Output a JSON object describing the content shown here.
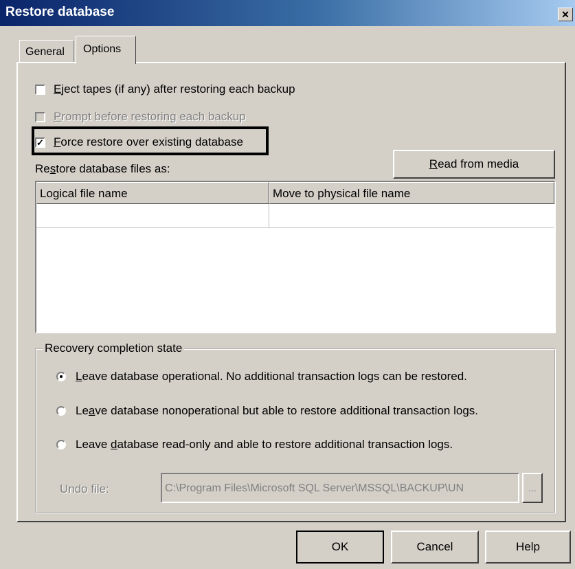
{
  "window": {
    "title": "Restore database",
    "close_icon": "close-icon"
  },
  "tabs": [
    {
      "label": "General"
    },
    {
      "label": "Options"
    }
  ],
  "options": {
    "eject": {
      "pre": "",
      "key": "E",
      "rest": "ject tapes (if any) after restoring each backup",
      "checked": false
    },
    "prompt": {
      "pre": "",
      "key": "P",
      "rest": "rompt before restoring each backup",
      "checked": false,
      "disabled": true
    },
    "force": {
      "pre": "",
      "key": "F",
      "rest": "orce restore over existing database",
      "checked": true
    }
  },
  "restore_files": {
    "label_pre": "Re",
    "label_key": "s",
    "label_rest": "tore database files as:",
    "read_button_key": "R",
    "read_button_rest": "ead from media",
    "columns": [
      "Logical file name",
      "Move to physical file name"
    ]
  },
  "recovery": {
    "legend": "Recovery completion state",
    "options": [
      {
        "key": "L",
        "rest": "eave database operational. No additional transaction logs can be restored.",
        "checked": true
      },
      {
        "pre": "Le",
        "key": "a",
        "rest": "ve database nonoperational but able to restore additional transaction logs.",
        "checked": false
      },
      {
        "pre": "Leave ",
        "key": "d",
        "rest": "atabase read-only and able to restore additional transaction logs.",
        "checked": false
      }
    ],
    "undo_label": "Undo file:",
    "undo_value": "C:\\Program Files\\Microsoft SQL Server\\MSSQL\\BACKUP\\UN",
    "browse_label": "..."
  },
  "buttons": {
    "ok": "OK",
    "cancel": "Cancel",
    "help": "Help"
  }
}
